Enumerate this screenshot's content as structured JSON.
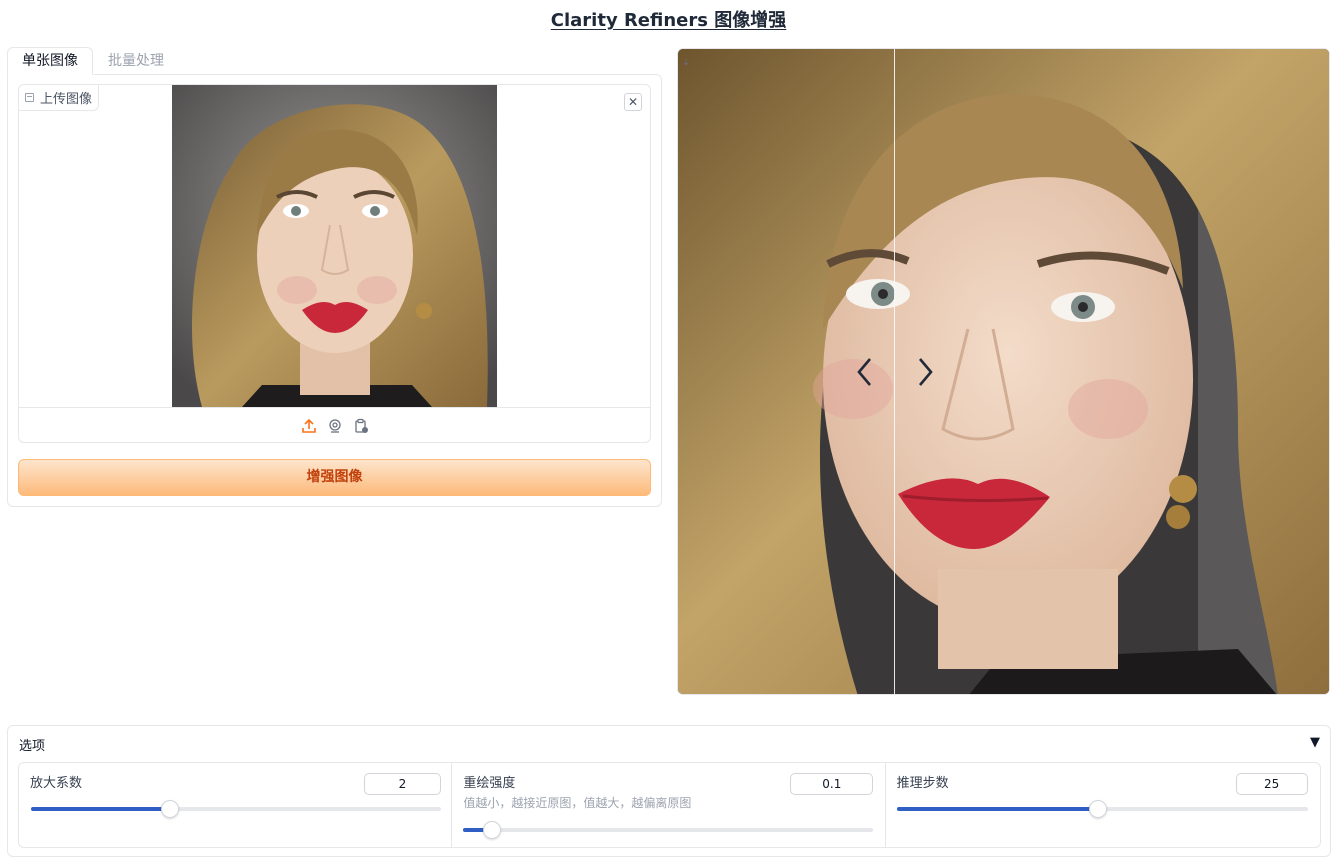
{
  "app": {
    "title": "Clarity Refiners 图像增强"
  },
  "tabs": [
    {
      "label": "单张图像",
      "active": true
    },
    {
      "label": "批量处理",
      "active": false
    }
  ],
  "upload": {
    "label": "上传图像",
    "clear_icon": "close-icon",
    "sources": [
      "upload-icon",
      "webcam-icon",
      "clipboard-icon"
    ]
  },
  "enhance_button": {
    "label": "增强图像"
  },
  "compare": {
    "download_icon": "download-icon",
    "prev_icon": "chevron-left-icon",
    "next_icon": "chevron-right-icon"
  },
  "options": {
    "title": "选项",
    "caret": "▼",
    "sliders": [
      {
        "label": "放大系数",
        "info": "",
        "value": "2",
        "fraction": 0.34
      },
      {
        "label": "重绘强度",
        "info": "值越小，越接近原图，值越大，越偏离原图",
        "value": "0.1",
        "fraction": 0.07
      },
      {
        "label": "推理步数",
        "info": "",
        "value": "25",
        "fraction": 0.49
      }
    ]
  },
  "colors": {
    "accent": "#2f5fc4",
    "button_text": "#c2410c",
    "button_bg": "#fdba7a",
    "lip": "#c8283a"
  }
}
